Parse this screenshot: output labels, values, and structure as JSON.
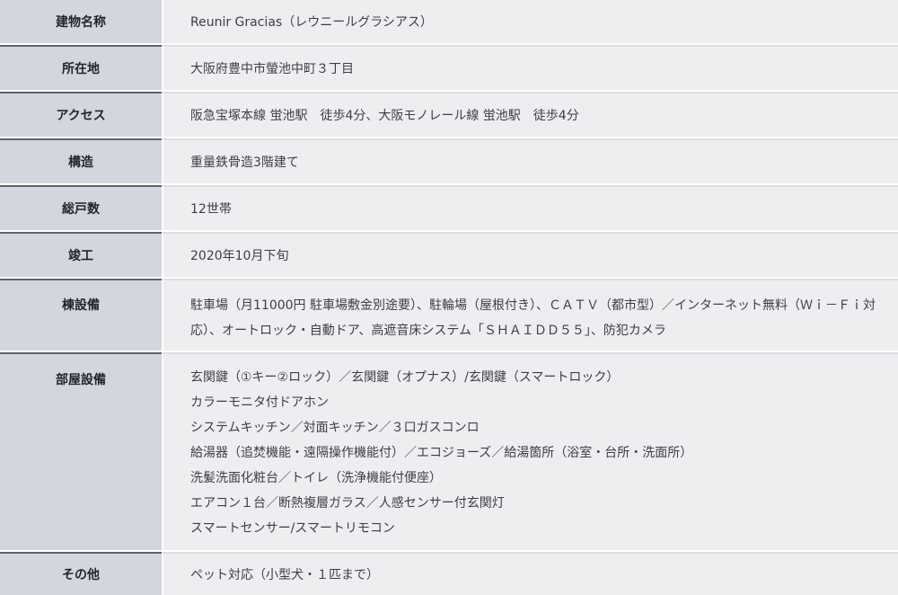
{
  "rows": [
    {
      "label": "建物名称",
      "value": "Reunir Gracias（レウニールグラシアス）"
    },
    {
      "label": "所在地",
      "value": "大阪府豊中市螢池中町３丁目"
    },
    {
      "label": "アクセス",
      "value": "阪急宝塚本線 蛍池駅　徒歩4分、大阪モノレール線 蛍池駅　徒歩4分"
    },
    {
      "label": "構造",
      "value": "重量鉄骨造3階建て"
    },
    {
      "label": "総戸数",
      "value": "12世帯"
    },
    {
      "label": "竣工",
      "value": "2020年10月下旬"
    },
    {
      "label": "棟設備",
      "value": "駐車場（月11000円 駐車場敷金別途要）、駐輪場（屋根付き）、ＣＡＴＶ（都市型）／インターネット無料（Ｗｉ－Ｆｉ対応）、オートロック・自動ドア、高遮音床システム「ＳＨＡＩＤＤ５５」、防犯カメラ"
    },
    {
      "label": "部屋設備",
      "lines": [
        "玄関鍵（①キー②ロック）／玄関鍵（オプナス）/玄関鍵（スマートロック）",
        "カラーモニタ付ドアホン",
        "システムキッチン／対面キッチン／３口ガスコンロ",
        "給湯器（追焚機能・遠隔操作機能付）／エコジョーズ／給湯箇所（浴室・台所・洗面所）",
        "洗髪洗面化粧台／トイレ（洗浄機能付便座）",
        "エアコン１台／断熱複層ガラス／人感センサー付玄関灯",
        "スマートセンサー/スマートリモコン"
      ]
    },
    {
      "label": "その他",
      "value": "ペット対応（小型犬・１匹まで）"
    }
  ]
}
